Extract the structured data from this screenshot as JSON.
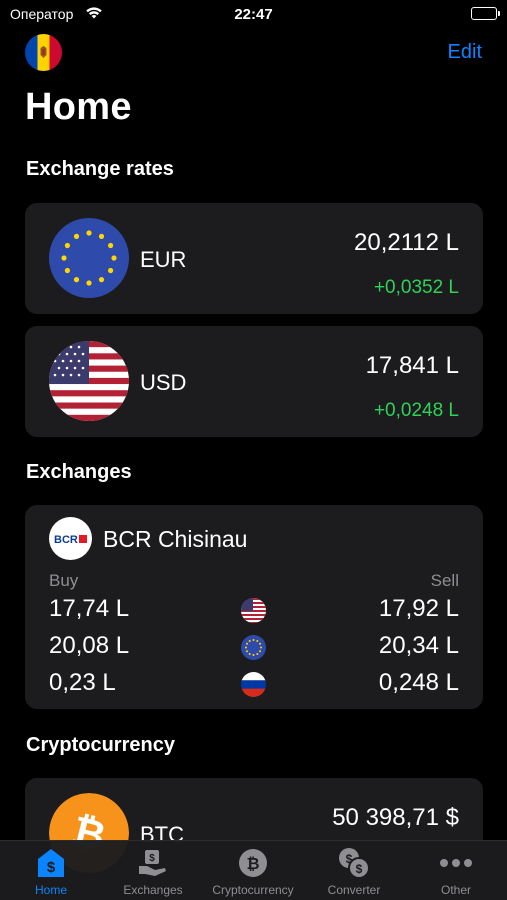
{
  "status_bar": {
    "carrier": "Оператор",
    "time": "22:47"
  },
  "header": {
    "edit_label": "Edit",
    "title": "Home"
  },
  "exchange_rates": {
    "heading": "Exchange rates",
    "items": [
      {
        "code": "EUR",
        "flag": "eu-flag-icon",
        "value": "20,2112 L",
        "change": "+0,0352 L"
      },
      {
        "code": "USD",
        "flag": "us-flag-icon",
        "value": "17,841 L",
        "change": "+0,0248 L"
      }
    ]
  },
  "exchanges": {
    "heading": "Exchanges",
    "bank": {
      "name": "BCR Chisinau",
      "logo_text": "BCR"
    },
    "buy_label": "Buy",
    "sell_label": "Sell",
    "rows": [
      {
        "currency_icon": "us-flag-icon",
        "buy": "17,74 L",
        "sell": "17,92 L"
      },
      {
        "currency_icon": "eu-flag-icon",
        "buy": "20,08 L",
        "sell": "20,34 L"
      },
      {
        "currency_icon": "ru-flag-icon",
        "buy": "0,23 L",
        "sell": "0,248 L"
      }
    ]
  },
  "cryptocurrency": {
    "heading": "Cryptocurrency",
    "items": [
      {
        "code": "BTC",
        "icon": "bitcoin-icon",
        "value": "50 398,71 $"
      }
    ]
  },
  "tab_bar": {
    "active": "Home",
    "tabs": [
      {
        "label": "Home",
        "icon": "home-dollar-icon"
      },
      {
        "label": "Exchanges",
        "icon": "exchanges-hand-icon"
      },
      {
        "label": "Cryptocurrency",
        "icon": "bitcoin-coin-icon"
      },
      {
        "label": "Converter",
        "icon": "converter-coins-icon"
      },
      {
        "label": "Other",
        "icon": "ellipsis-icon"
      }
    ]
  },
  "colors": {
    "accent": "#0a84ff",
    "positive": "#30d158",
    "card": "#1c1c1e",
    "background": "#000000",
    "secondary_text": "#8e8e93"
  }
}
